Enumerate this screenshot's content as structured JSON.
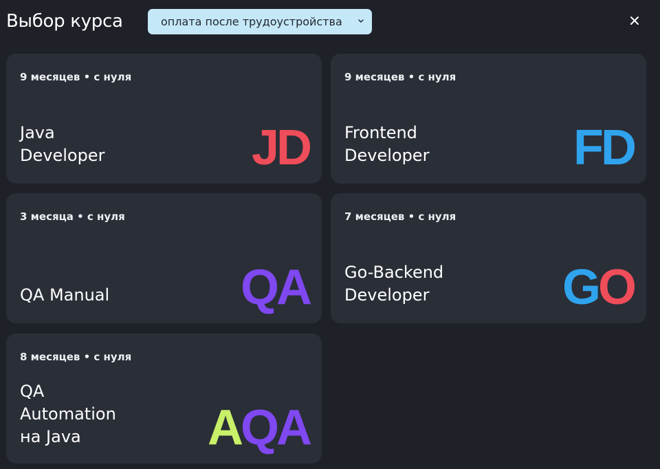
{
  "header": {
    "title": "Выбор курса",
    "filter_value": "оплата после трудоустройства",
    "close_label": "×"
  },
  "colors": {
    "background": "#1e2128",
    "card": "#2a2e37",
    "filter_bg": "#c5e8f8",
    "red": "#ef4d5a",
    "blue": "#30a3ee",
    "purple": "#7f48f0",
    "lime": "#c8f068"
  },
  "courses": [
    {
      "meta": "9 месяцев • с нуля",
      "name_lines": [
        "Java",
        "Developer"
      ],
      "abbr": [
        {
          "text": "JD",
          "color": "#ef4d5a"
        }
      ]
    },
    {
      "meta": "9 месяцев • с нуля",
      "name_lines": [
        "Frontend",
        "Developer"
      ],
      "abbr": [
        {
          "text": "FD",
          "color": "#30a3ee"
        }
      ]
    },
    {
      "meta": "3 месяца • с нуля",
      "name_lines": [
        "QA Manual"
      ],
      "abbr": [
        {
          "text": "QA",
          "color": "#7f48f0"
        }
      ]
    },
    {
      "meta": "7 месяцев • с нуля",
      "name_lines": [
        "Go-Backend",
        "Developer"
      ],
      "abbr": [
        {
          "text": "G",
          "color": "#30a3ee"
        },
        {
          "text": "O",
          "color": "#ef4d5a"
        }
      ]
    },
    {
      "meta": "8 месяцев • с нуля",
      "name_lines": [
        "QA",
        "Automation",
        "на Java"
      ],
      "abbr": [
        {
          "text": "A",
          "color": "#c8f068"
        },
        {
          "text": "QA",
          "color": "#7f48f0"
        }
      ]
    }
  ]
}
